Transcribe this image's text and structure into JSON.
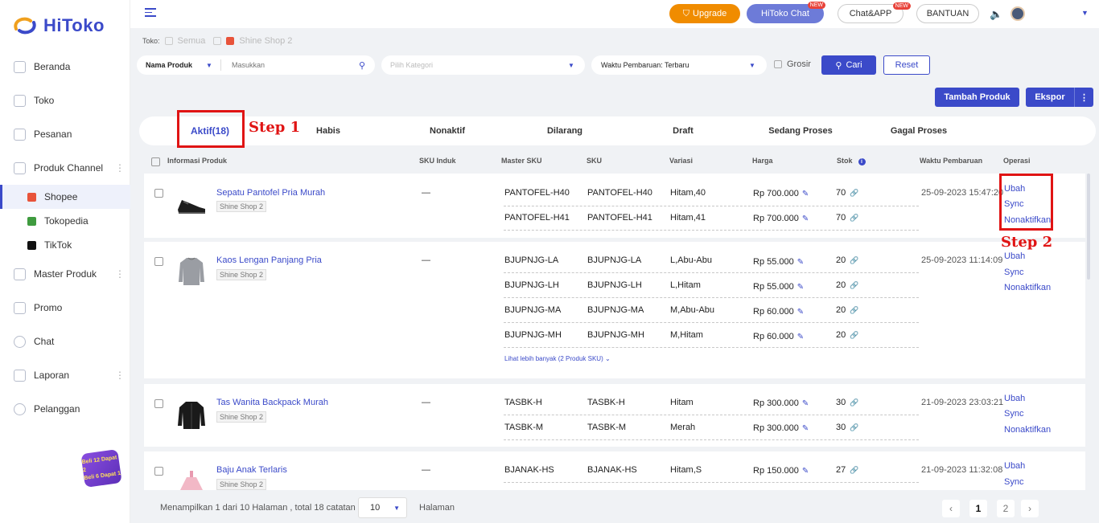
{
  "app": {
    "name": "HiToko"
  },
  "colors": {
    "accent": "#3b4ac9",
    "upgrade": "#f08c00",
    "annotation": "#e01414"
  },
  "sidebar": {
    "items": [
      {
        "label": "Beranda",
        "icon": "home-icon"
      },
      {
        "label": "Toko",
        "icon": "store-icon"
      },
      {
        "label": "Pesanan",
        "icon": "orders-icon"
      },
      {
        "label": "Produk Channel",
        "icon": "grid-icon"
      },
      {
        "label": "Master Produk",
        "icon": "box-icon"
      },
      {
        "label": "Promo",
        "icon": "promo-icon"
      },
      {
        "label": "Chat",
        "icon": "chat-icon"
      },
      {
        "label": "Laporan",
        "icon": "report-icon"
      },
      {
        "label": "Pelanggan",
        "icon": "customers-icon"
      }
    ],
    "sub_items": [
      {
        "label": "Shopee",
        "icon": "shopee-icon"
      },
      {
        "label": "Tokopedia",
        "icon": "tokopedia-icon"
      },
      {
        "label": "TikTok",
        "icon": "tiktok-icon"
      }
    ],
    "promo_badge": {
      "line1": "Beli 12 Dapat 2",
      "line2": "Beli 6 Dapat 1"
    }
  },
  "topbar": {
    "upgrade": "Upgrade",
    "hitoko_chat": "HiToko Chat",
    "chat_app": "Chat&APP",
    "bantuan": "BANTUAN",
    "new_tag": "NEW"
  },
  "filters": {
    "toko_label": "Toko:",
    "semua": "Semua",
    "shop": "Shine Shop 2",
    "field_select": "Nama Produk",
    "search_placeholder": "Masukkan",
    "category_placeholder": "Pilih Kategori",
    "sort": "Waktu Pembaruan: Terbaru",
    "grosir": "Grosir",
    "cari": "Cari",
    "reset": "Reset"
  },
  "actions": {
    "tambah": "Tambah Produk",
    "ekspor": "Ekspor"
  },
  "tabs": [
    "Aktif(18)",
    "Habis",
    "Nonaktif",
    "Dilarang",
    "Draft",
    "Sedang Proses",
    "Gagal Proses"
  ],
  "annotations": {
    "step1": "Step 1",
    "step2": "Step 2"
  },
  "columns": [
    "Informasi Produk",
    "SKU Induk",
    "Master SKU",
    "SKU",
    "Variasi",
    "Harga",
    "Stok",
    "Waktu Pembaruan",
    "Operasi"
  ],
  "operations": {
    "ubah": "Ubah",
    "sync": "Sync",
    "nonaktifkan": "Nonaktifkan"
  },
  "products": [
    {
      "name": "Sepatu Pantofel Pria Murah",
      "shop": "Shine Shop 2",
      "sku_induk": "—",
      "updated": "25-09-2023 15:47:20",
      "variants": [
        {
          "master": "PANTOFEL-H40",
          "sku": "PANTOFEL-H40",
          "var": "Hitam,40",
          "price": "Rp 700.000",
          "stock": "70"
        },
        {
          "master": "PANTOFEL-H41",
          "sku": "PANTOFEL-H41",
          "var": "Hitam,41",
          "price": "Rp 700.000",
          "stock": "70"
        }
      ]
    },
    {
      "name": "Kaos Lengan Panjang Pria",
      "shop": "Shine Shop 2",
      "sku_induk": "—",
      "updated": "25-09-2023 11:14:09",
      "variants": [
        {
          "master": "BJUPNJG-LA",
          "sku": "BJUPNJG-LA",
          "var": "L,Abu-Abu",
          "price": "Rp 55.000",
          "stock": "20"
        },
        {
          "master": "BJUPNJG-LH",
          "sku": "BJUPNJG-LH",
          "var": "L,Hitam",
          "price": "Rp 55.000",
          "stock": "20"
        },
        {
          "master": "BJUPNJG-MA",
          "sku": "BJUPNJG-MA",
          "var": "M,Abu-Abu",
          "price": "Rp 60.000",
          "stock": "20"
        },
        {
          "master": "BJUPNJG-MH",
          "sku": "BJUPNJG-MH",
          "var": "M,Hitam",
          "price": "Rp 60.000",
          "stock": "20"
        }
      ],
      "more": "Lihat lebih banyak (2 Produk SKU)"
    },
    {
      "name": "Tas Wanita Backpack Murah",
      "shop": "Shine Shop 2",
      "sku_induk": "—",
      "updated": "21-09-2023 23:03:21",
      "variants": [
        {
          "master": "TASBK-H",
          "sku": "TASBK-H",
          "var": "Hitam",
          "price": "Rp 300.000",
          "stock": "30"
        },
        {
          "master": "TASBK-M",
          "sku": "TASBK-M",
          "var": "Merah",
          "price": "Rp 300.000",
          "stock": "30"
        }
      ]
    },
    {
      "name": "Baju Anak Terlaris",
      "shop": "Shine Shop 2",
      "sku_induk": "—",
      "updated": "21-09-2023 11:32:08",
      "variants": [
        {
          "master": "BJANAK-HS",
          "sku": "BJANAK-HS",
          "var": "Hitam,S",
          "price": "Rp 150.000",
          "stock": "27"
        }
      ]
    }
  ],
  "footer": {
    "showing": "Menampilkan 1 dari 10 Halaman , total 18 catatan",
    "per_page": "10",
    "halaman": "Halaman",
    "pages": [
      "1",
      "2"
    ],
    "prev": "‹",
    "next": "›"
  }
}
